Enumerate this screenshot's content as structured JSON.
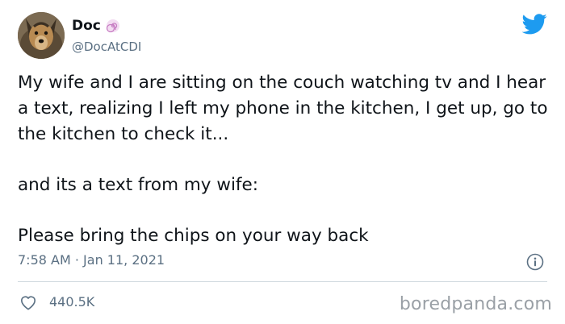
{
  "tweet": {
    "author": {
      "display_name": "Doc",
      "handle": "@DocAtCDI",
      "badge_icon": "swirl-emoji-icon",
      "avatar": "dog-avatar"
    },
    "platform_icon": "twitter-bird-icon",
    "text": {
      "line1": "My wife and I are sitting on the couch watching tv and I hear a text, realizing I left my phone in the kitchen, I get up, go to the kitchen to check it...",
      "line2": "and its a text from my wife:",
      "line3": "Please bring the chips on your way back"
    },
    "meta": {
      "time": "7:58 AM",
      "separator": "·",
      "date": "Jan 11, 2021"
    },
    "info_icon": "info-icon",
    "likes": {
      "icon": "heart-icon",
      "count": "440.5K"
    }
  },
  "watermark": "boredpanda.com",
  "colors": {
    "twitter_blue": "#1d9bf0",
    "muted_text": "#5b7083",
    "body_text": "#0f1419",
    "badge_pink": "#d9a0d6"
  }
}
